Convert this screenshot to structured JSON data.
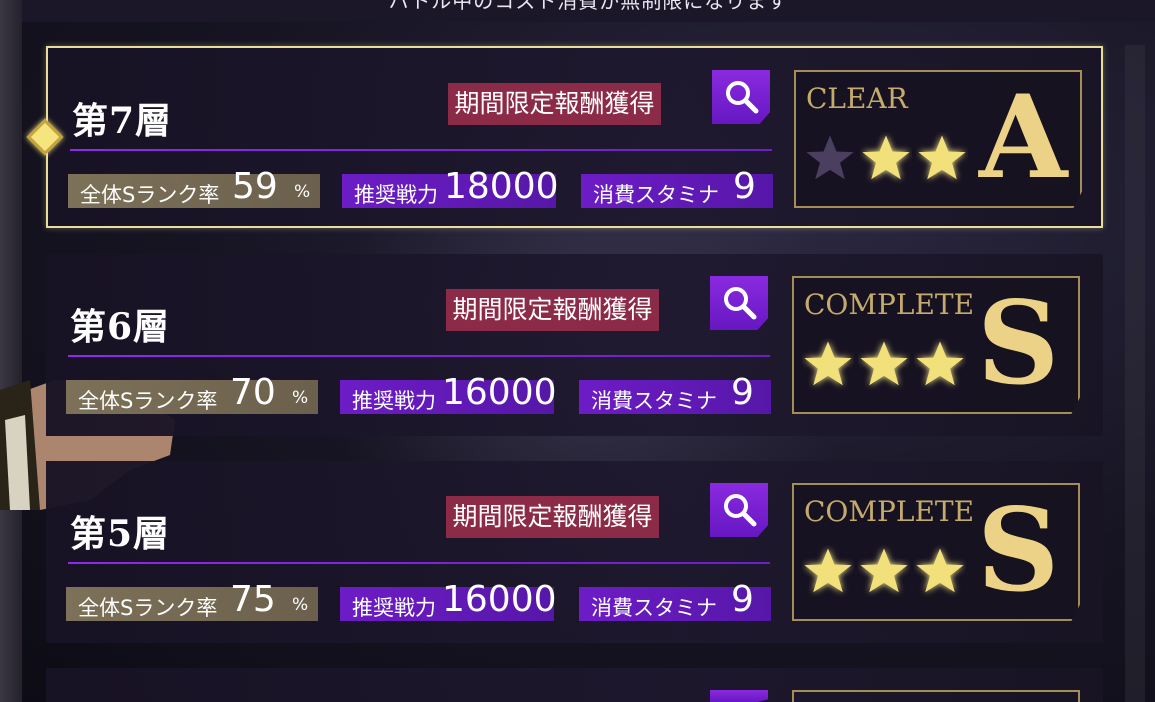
{
  "header": {
    "text": "バトル中のコスト消費が無制限になります"
  },
  "floors": [
    {
      "title": "第7層",
      "reward_label": "期間限定報酬獲得",
      "s_rank_label": "全体Sランク率",
      "s_rank_value": "59",
      "s_rank_unit": "%",
      "power_label": "推奨戦力",
      "power_value": "18000",
      "stamina_label": "消費スタミナ",
      "stamina_value": "9",
      "status": "CLEAR",
      "stars_earned": 2,
      "stars_total": 3,
      "rank": "A",
      "selected": true
    },
    {
      "title": "第6層",
      "reward_label": "期間限定報酬獲得",
      "s_rank_label": "全体Sランク率",
      "s_rank_value": "70",
      "s_rank_unit": "%",
      "power_label": "推奨戦力",
      "power_value": "16000",
      "stamina_label": "消費スタミナ",
      "stamina_value": "9",
      "status": "COMPLETE",
      "stars_earned": 3,
      "stars_total": 3,
      "rank": "S",
      "selected": false
    },
    {
      "title": "第5層",
      "reward_label": "期間限定報酬獲得",
      "s_rank_label": "全体Sランク率",
      "s_rank_value": "75",
      "s_rank_unit": "%",
      "power_label": "推奨戦力",
      "power_value": "16000",
      "stamina_label": "消費スタミナ",
      "stamina_value": "9",
      "status": "COMPLETE",
      "stars_earned": 3,
      "stars_total": 3,
      "rank": "S",
      "selected": false
    }
  ],
  "icons": {
    "search": "magnifier-icon",
    "star": "star-icon",
    "marker": "diamond-icon"
  },
  "colors": {
    "star_gold": "#f2e07a",
    "star_empty": "#4a3f5f",
    "accent_purple": "#7a22d8",
    "reward_red": "#8c2b47",
    "selected_border": "#e9dd9c"
  }
}
